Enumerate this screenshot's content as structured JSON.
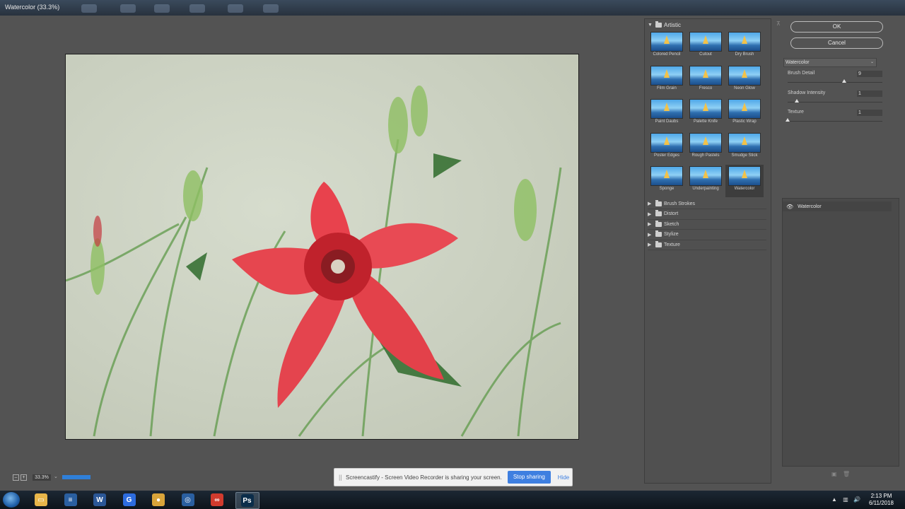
{
  "window": {
    "title": "Watercolor (33.3%)"
  },
  "canvas": {
    "zoom_minus": "–",
    "zoom_plus": "+",
    "zoom_value": "33.3%",
    "progress_fraction": 0.45
  },
  "gallery": {
    "artistic_label": "Artistic",
    "thumbs": [
      "Colored Pencil",
      "Cutout",
      "Dry Brush",
      "Film Grain",
      "Fresco",
      "Neon Glow",
      "Paint Daubs",
      "Palette Knife",
      "Plastic Wrap",
      "Poster Edges",
      "Rough Pastels",
      "Smudge Stick",
      "Sponge",
      "Underpainting",
      "Watercolor"
    ],
    "selected": "Watercolor",
    "categories": [
      "Brush Strokes",
      "Distort",
      "Sketch",
      "Stylize",
      "Texture"
    ]
  },
  "settings": {
    "ok_label": "OK",
    "cancel_label": "Cancel",
    "filter_select": "Watercolor",
    "params": [
      {
        "label": "Brush Detail",
        "value": "9",
        "level": 0.6
      },
      {
        "label": "Shadow Intensity",
        "value": "1",
        "level": 0.1
      },
      {
        "label": "Texture",
        "value": "1",
        "level": 0.0
      }
    ],
    "layer_name": "Watercolor"
  },
  "share_bar": {
    "grip": "||",
    "message": "Screencastify - Screen Video Recorder is sharing your screen.",
    "stop_label": "Stop sharing",
    "hide_label": "Hide"
  },
  "taskbar": {
    "items": [
      {
        "icon": "file-explorer-icon",
        "glyph": "▭",
        "color": "#e8b64a"
      },
      {
        "icon": "app-icon",
        "glyph": "≡",
        "color": "#2a5fa0"
      },
      {
        "icon": "word-icon",
        "glyph": "W",
        "color": "#2b5797"
      },
      {
        "icon": "google-icon",
        "glyph": "G",
        "color": "#2d6cdf"
      },
      {
        "icon": "chrome-icon",
        "glyph": "●",
        "color": "#d9a43a"
      },
      {
        "icon": "app-icon",
        "glyph": "◎",
        "color": "#2a5fa0"
      },
      {
        "icon": "creative-cloud-icon",
        "glyph": "∞",
        "color": "#d13b2e"
      },
      {
        "icon": "photoshop-icon",
        "glyph": "Ps",
        "color": "#0b2d4a"
      }
    ],
    "clock_time": "2:13 PM",
    "clock_date": "6/11/2018"
  }
}
